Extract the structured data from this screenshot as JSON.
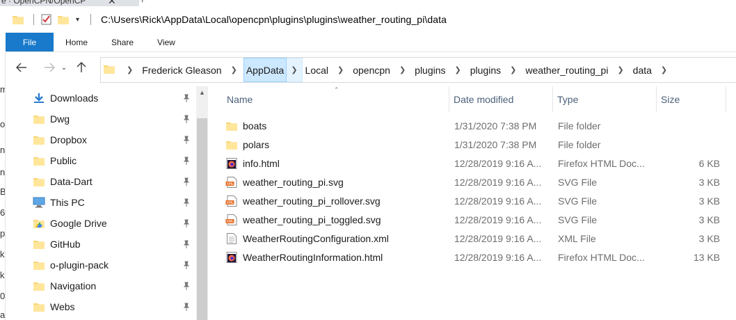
{
  "background": {
    "browser_tab_title": "e · OpenCPN/OpenCP",
    "browser_tab_close": "✕",
    "browser_new_tab": "+",
    "side_letters": [
      "m",
      "o",
      "na",
      "na",
      "B",
      "6",
      "pi",
      "k",
      "k",
      "0",
      "a"
    ]
  },
  "titlebar": {
    "path": "C:\\Users\\Rick\\AppData\\Local\\opencpn\\plugins\\plugins\\weather_routing_pi\\data"
  },
  "ribbon": {
    "tabs": [
      "File",
      "Home",
      "Share",
      "View"
    ]
  },
  "address": {
    "crumbs": [
      "Frederick Gleason",
      "AppData",
      "Local",
      "opencpn",
      "plugins",
      "plugins",
      "weather_routing_pi",
      "data"
    ],
    "highlighted": "AppData"
  },
  "navpane": {
    "items": [
      {
        "label": "Downloads",
        "icon": "download-icon"
      },
      {
        "label": "Dwg",
        "icon": "folder-icon"
      },
      {
        "label": "Dropbox",
        "icon": "folder-icon"
      },
      {
        "label": "Public",
        "icon": "folder-icon"
      },
      {
        "label": "Data-Dart",
        "icon": "folder-icon"
      },
      {
        "label": "This PC",
        "icon": "computer-icon"
      },
      {
        "label": "Google Drive",
        "icon": "google-drive-icon"
      },
      {
        "label": "GitHub",
        "icon": "folder-icon"
      },
      {
        "label": "o-plugin-pack",
        "icon": "folder-icon"
      },
      {
        "label": "Navigation",
        "icon": "folder-icon"
      },
      {
        "label": "Webs",
        "icon": "folder-icon"
      }
    ]
  },
  "columns": {
    "name": "Name",
    "date": "Date modified",
    "type": "Type",
    "size": "Size"
  },
  "files": [
    {
      "name": "boats",
      "date": "1/31/2020 7:38 PM",
      "type": "File folder",
      "size": "",
      "icon": "folder-icon"
    },
    {
      "name": "polars",
      "date": "1/31/2020 7:38 PM",
      "type": "File folder",
      "size": "",
      "icon": "folder-icon"
    },
    {
      "name": "info.html",
      "date": "12/28/2019 9:16 A...",
      "type": "Firefox HTML Doc...",
      "size": "6 KB",
      "icon": "firefox-html-icon"
    },
    {
      "name": "weather_routing_pi.svg",
      "date": "12/28/2019 9:16 A...",
      "type": "SVG File",
      "size": "3 KB",
      "icon": "xml-file-icon"
    },
    {
      "name": "weather_routing_pi_rollover.svg",
      "date": "12/28/2019 9:16 A...",
      "type": "SVG File",
      "size": "3 KB",
      "icon": "xml-file-icon"
    },
    {
      "name": "weather_routing_pi_toggled.svg",
      "date": "12/28/2019 9:16 A...",
      "type": "SVG File",
      "size": "3 KB",
      "icon": "xml-file-icon"
    },
    {
      "name": "WeatherRoutingConfiguration.xml",
      "date": "12/28/2019 9:16 A...",
      "type": "XML File",
      "size": "3 KB",
      "icon": "text-file-icon"
    },
    {
      "name": "WeatherRoutingInformation.html",
      "date": "12/28/2019 9:16 A...",
      "type": "Firefox HTML Doc...",
      "size": "13 KB",
      "icon": "firefox-html-icon"
    }
  ],
  "colors": {
    "accent": "#1979ca",
    "folder": "#f8d775",
    "selection": "#cce8ff"
  }
}
